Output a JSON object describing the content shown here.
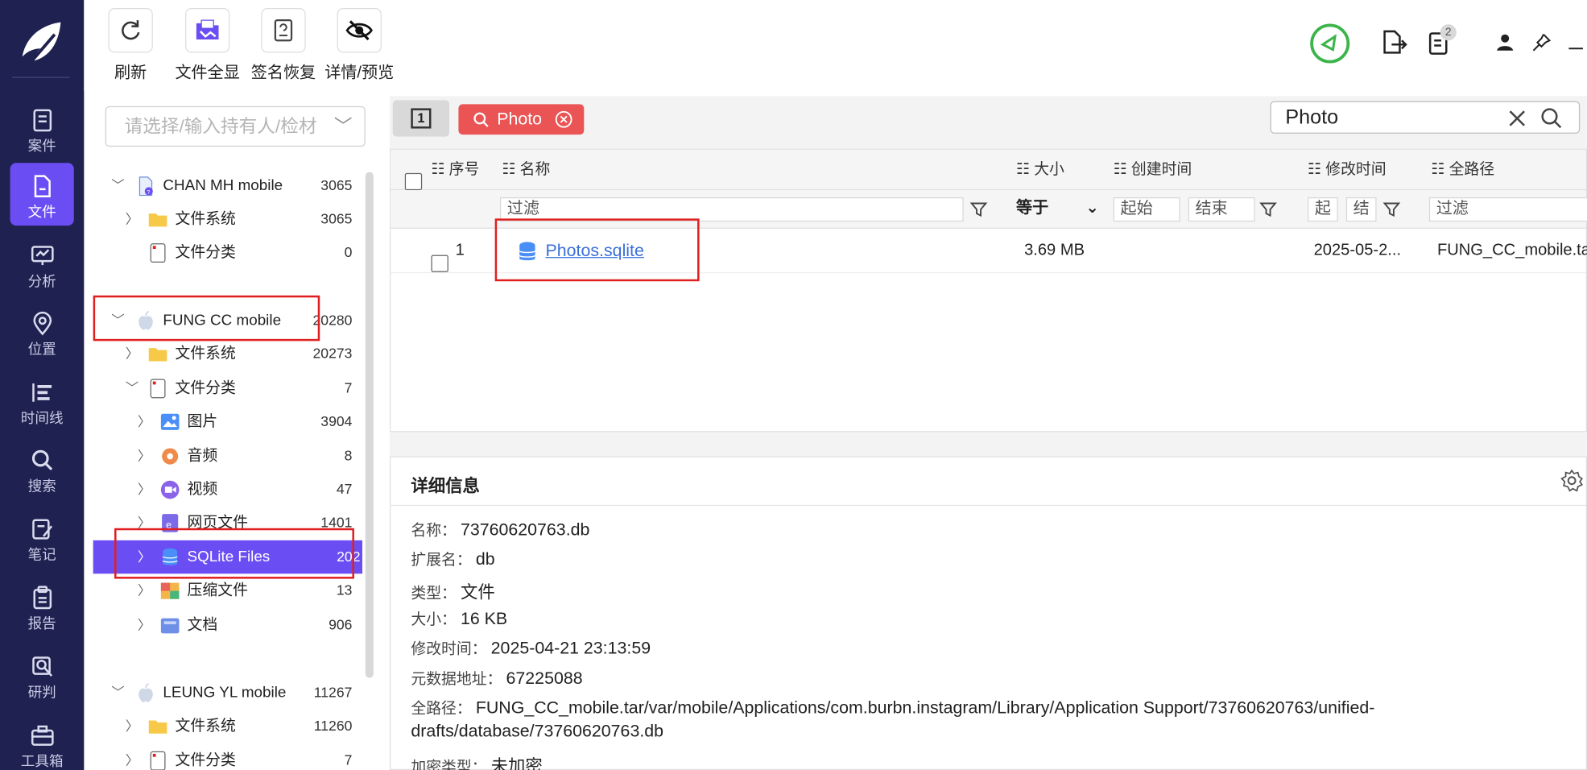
{
  "nav": {
    "items": [
      {
        "label": "案件",
        "icon": "case-icon"
      },
      {
        "label": "文件",
        "icon": "file-icon"
      },
      {
        "label": "分析",
        "icon": "analysis-icon"
      },
      {
        "label": "位置",
        "icon": "location-icon"
      },
      {
        "label": "时间线",
        "icon": "timeline-icon"
      },
      {
        "label": "搜索",
        "icon": "search-icon"
      },
      {
        "label": "笔记",
        "icon": "note-icon"
      },
      {
        "label": "报告",
        "icon": "report-icon"
      },
      {
        "label": "研判",
        "icon": "judge-icon"
      },
      {
        "label": "工具箱",
        "icon": "toolbox-icon"
      }
    ],
    "active_index": 1
  },
  "toolbar": {
    "refresh": "刷新",
    "show_all": "文件全显",
    "sig_recover": "签名恢复",
    "detail_preview": "详情/预览",
    "badge_count": "2"
  },
  "left": {
    "selector_placeholder": "请选择/输入持有人/检材",
    "tree": [
      {
        "label": "CHAN MH mobile",
        "count": "3065"
      },
      {
        "label": "文件系统",
        "count": "3065"
      },
      {
        "label": "文件分类",
        "count": "0"
      },
      {
        "label": "FUNG CC mobile",
        "count": "20280"
      },
      {
        "label": "文件系统",
        "count": "20273"
      },
      {
        "label": "文件分类",
        "count": "7"
      },
      {
        "label": "图片",
        "count": "3904"
      },
      {
        "label": "音频",
        "count": "8"
      },
      {
        "label": "视频",
        "count": "47"
      },
      {
        "label": "网页文件",
        "count": "1401"
      },
      {
        "label": "SQLite Files",
        "count": "202"
      },
      {
        "label": "压缩文件",
        "count": "13"
      },
      {
        "label": "文档",
        "count": "906"
      },
      {
        "label": "LEUNG YL mobile",
        "count": "11267"
      },
      {
        "label": "文件系统",
        "count": "11260"
      },
      {
        "label": "文件分类",
        "count": "7"
      }
    ]
  },
  "search": {
    "tag": "Photo",
    "value": "Photo",
    "view_number": "1"
  },
  "grid": {
    "headers": {
      "seq": "序号",
      "name": "名称",
      "size": "大小",
      "created": "创建时间",
      "modified": "修改时间",
      "path": "全路径"
    },
    "filters": {
      "name": "过滤",
      "size_op": "等于",
      "created_start": "起始",
      "created_end": "结束",
      "mod_start": "起",
      "mod_end": "结",
      "path": "过滤"
    },
    "rows": [
      {
        "seq": "1",
        "name": "Photos.sqlite",
        "size": "3.69 MB",
        "created": "",
        "modified": "2025-05-2...",
        "path": "FUNG_CC_mobile.ta"
      }
    ]
  },
  "detail": {
    "title": "详细信息",
    "fields": [
      {
        "k": "名称：",
        "v": "73760620763.db"
      },
      {
        "k": "扩展名：",
        "v": "db"
      },
      {
        "k": "类型：",
        "v": "文件"
      },
      {
        "k": "大小：",
        "v": "16 KB"
      },
      {
        "k": "修改时间：",
        "v": "2025-04-21 23:13:59"
      },
      {
        "k": "元数据地址：",
        "v": "67225088"
      },
      {
        "k": "全路径：",
        "v": "FUNG_CC_mobile.tar/var/mobile/Applications/com.burbn.instagram/Library/Application Support/73760620763/unified-"
      },
      {
        "k": "",
        "v": "drafts/database/73760620763.db"
      },
      {
        "k": "加密类型：",
        "v": "未加密"
      }
    ]
  },
  "colors": {
    "nav_bg": "#1f2150",
    "accent": "#6b4ef3",
    "tag": "#ea5455",
    "highlight": "#e02020"
  }
}
